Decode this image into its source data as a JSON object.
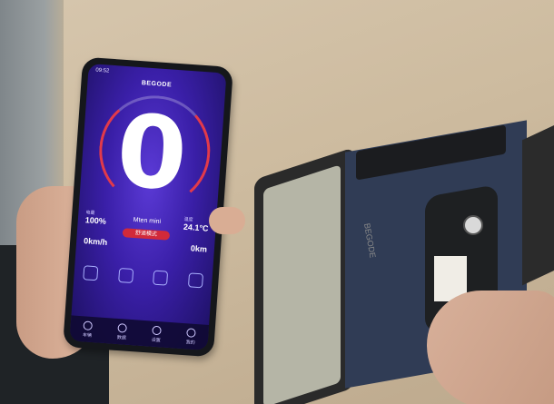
{
  "phone": {
    "status_time": "09:52",
    "brand": "BEGODE",
    "speed": "0",
    "model": "Mten mini",
    "mode_label": "舒适模式",
    "stats": {
      "left_top": {
        "value": "100%",
        "label": "电量"
      },
      "left_bottom": {
        "value": "0km/h",
        "label": ""
      },
      "right_top": {
        "value": "24.1°C",
        "label": "温度"
      },
      "right_bottom": {
        "value": "0km",
        "label": ""
      }
    },
    "nav": [
      "车辆",
      "数据",
      "设置",
      "我的"
    ]
  },
  "device": {
    "label_text": "BEGODE"
  },
  "colors": {
    "screen": "#3a1fa8",
    "accent": "#e23a4a"
  }
}
